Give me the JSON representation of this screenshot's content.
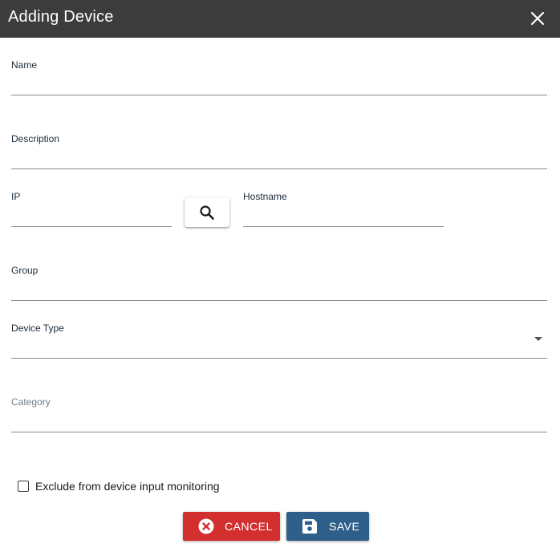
{
  "dialog": {
    "title": "Adding Device",
    "close_icon": "close-icon"
  },
  "form": {
    "name": {
      "label": "Name",
      "value": ""
    },
    "description": {
      "label": "Description",
      "value": ""
    },
    "ip": {
      "label": "IP",
      "value": ""
    },
    "search_icon": "search-icon",
    "hostname": {
      "label": "Hostname",
      "value": ""
    },
    "group": {
      "label": "Group",
      "value": ""
    },
    "device_type": {
      "label": "Device Type",
      "value": ""
    },
    "category": {
      "label": "Category",
      "value": ""
    },
    "exclude_monitoring": {
      "label": "Exclude from device input monitoring",
      "checked": false
    }
  },
  "actions": {
    "cancel_label": "CANCEL",
    "save_label": "SAVE"
  },
  "colors": {
    "titlebar": "#3c3c3c",
    "cancel": "#d32f2f",
    "save": "#2e5f8a"
  }
}
